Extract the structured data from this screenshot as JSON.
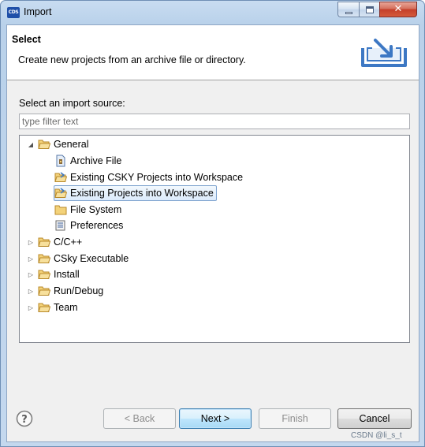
{
  "window": {
    "title": "Import",
    "app_icon_text": "CDS"
  },
  "header": {
    "title": "Select",
    "description": "Create new projects from an archive file or directory."
  },
  "body": {
    "source_label": "Select an import source:",
    "filter_placeholder": "type filter text"
  },
  "tree": {
    "general": "General",
    "archive_file": "Archive File",
    "existing_csky": "Existing CSKY Projects into Workspace",
    "existing_projects": "Existing Projects into Workspace",
    "file_system": "File System",
    "preferences": "Preferences",
    "cpp": "C/C++",
    "csky_executable": "CSky Executable",
    "install": "Install",
    "run_debug": "Run/Debug",
    "team": "Team",
    "selected_item": "Existing Projects into Workspace"
  },
  "buttons": {
    "back": "< Back",
    "next": "Next >",
    "finish": "Finish",
    "cancel": "Cancel"
  },
  "watermark": "CSDN @li_s_t",
  "colors": {
    "selection_border": "#7da2ce",
    "folder": "#e8b84a",
    "title_gradient": "#b9d1ea"
  }
}
